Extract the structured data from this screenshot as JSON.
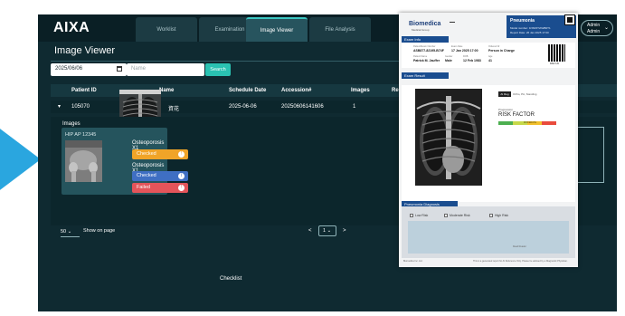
{
  "app": {
    "logo": "AIXA"
  },
  "tabs": [
    {
      "label": "Worklist"
    },
    {
      "label": "Examination"
    },
    {
      "label": "Image Viewer"
    },
    {
      "label": "File Analysis"
    }
  ],
  "user": {
    "name": "Admin",
    "role": "Admin"
  },
  "page": {
    "title": "Image Viewer"
  },
  "filters": {
    "date_value": "2025/06/06",
    "name_placeholder": "Name",
    "search_label": "Search"
  },
  "table": {
    "columns": [
      "Patient ID",
      "Name",
      "Schedule Date",
      "Accession#",
      "Images",
      "Re"
    ],
    "row": {
      "patient_id": "105070",
      "name": "資花",
      "schedule_date": "2025-06-06",
      "accession": "20250606141606",
      "images": "1"
    }
  },
  "detail": {
    "images_label": "Images",
    "card_title": "HIP AP 12345",
    "groups": [
      {
        "label": "Osteoporosis X1",
        "status": "Checked",
        "color": "#f0a428",
        "dot": "!"
      },
      {
        "label": "Osteoporosis X1",
        "status": "Checked",
        "color": "#3f6fc3",
        "dot": "i"
      },
      {
        "label": "",
        "status": "Failed",
        "color": "#e4545a",
        "dot": "!"
      }
    ]
  },
  "pagination": {
    "per_page": "50",
    "per_page_label": "Show on page",
    "prev": "<",
    "current": "1",
    "next": ">"
  },
  "footer": {
    "checklist": "Checklist"
  },
  "report": {
    "logo": "Biomedica",
    "logo_sub": "Medical Group",
    "type_title": "Pneumonia",
    "type_lines": [
      "Model number: 1NSF6T2N2B0T1",
      "Report Date: 26 Jan 2025 17:00"
    ],
    "exam_info_label": "Exam Info",
    "exam_labels": [
      "Patient/Exam Number",
      "Exam Date",
      "Ordered Dr",
      "Patient Name",
      "Gender",
      "DOB",
      "Age"
    ],
    "exam_values": [
      "ASB877-82195-B74F",
      "17 Jan 2025 17:00",
      "Person in Charge",
      "Patrick M. Jauffer",
      "Male",
      "12 Feb 1983",
      "41"
    ],
    "qr_caption": "DAILY-AI",
    "exam_result_label": "Exam Result",
    "chip": "AI Reg",
    "tag_text": "Ortho, PA, Standing",
    "progression_label": "Progression",
    "risk_title": "RISK FACTOR",
    "risk_bar_label": "MODERATE",
    "risk_colors": [
      "#4caf50",
      "#c6d94a",
      "#f2c12e",
      "#e94b3c"
    ],
    "diag_label": "Pneumonia Diagnosis",
    "diag_options": [
      "Low Risk",
      "Moderate Risk",
      "High Risk"
    ],
    "diag_note": "Read Reader",
    "foot_left": "Biomedica Inc. Ltd.",
    "foot_right": "This is a generated report for AI Reference Only. Please be advised by a Diagnostic Physician."
  }
}
